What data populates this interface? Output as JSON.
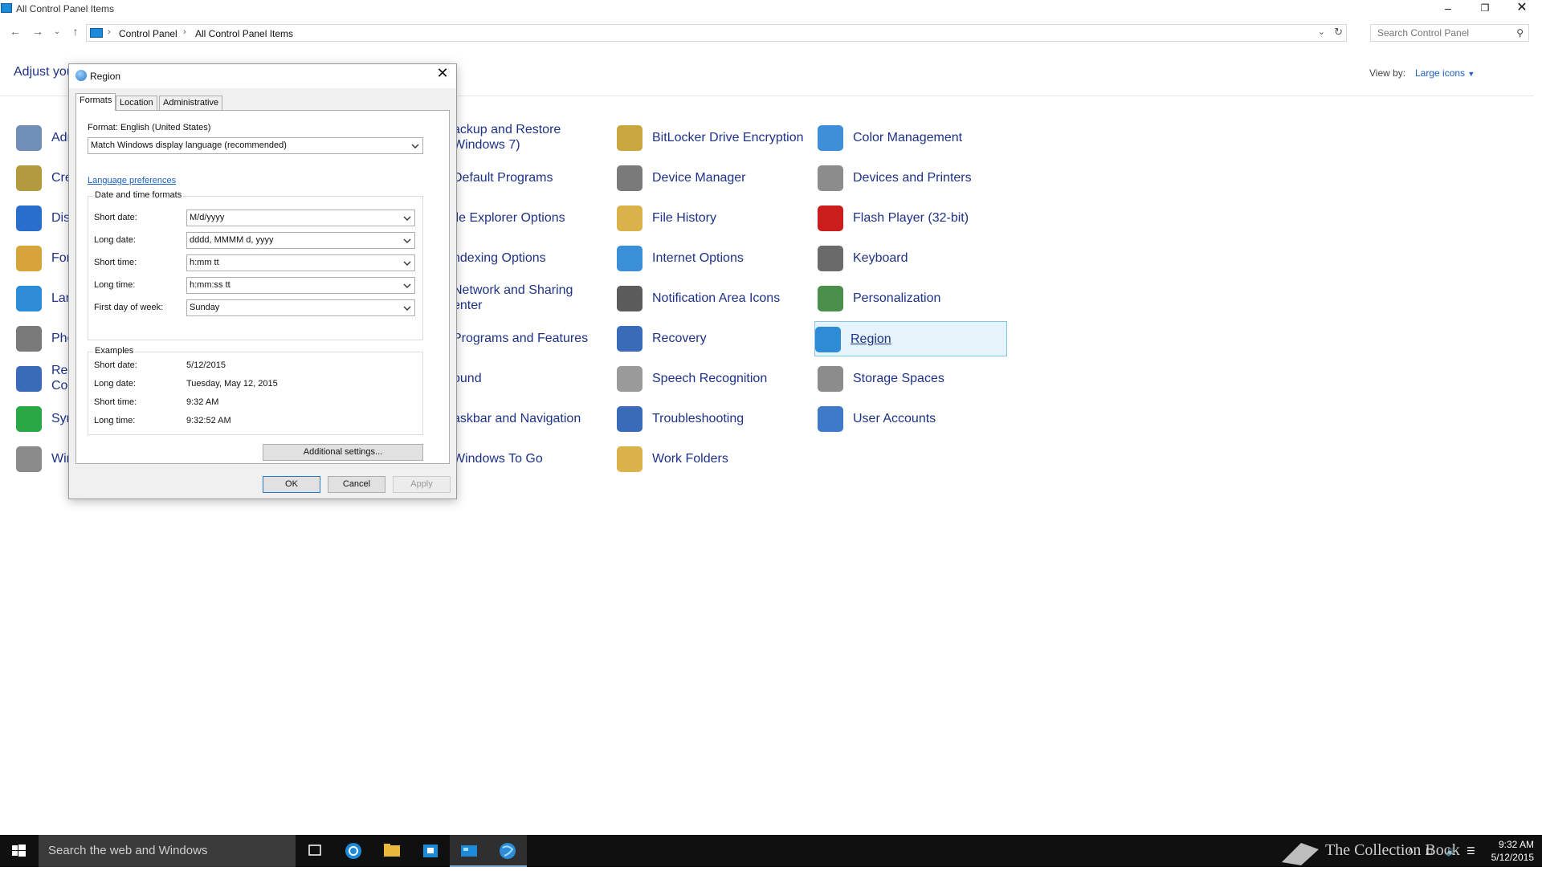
{
  "window": {
    "title": "All Control Panel Items"
  },
  "address": {
    "crumbs": [
      "Control Panel",
      "All Control Panel Items"
    ],
    "search_placeholder": "Search Control Panel"
  },
  "header": {
    "title": "Adjust you",
    "view_by_label": "View by:",
    "view_by_value": "Large icons"
  },
  "items": [
    {
      "label": "Adr",
      "color": "#6f8fb7"
    },
    {
      "label": "Cre",
      "color": "#b39a3f"
    },
    {
      "label": "Dis",
      "color": "#2a6ecc"
    },
    {
      "label": "For",
      "color": "#d6a43a"
    },
    {
      "label": "Lan",
      "color": "#2e8bd6"
    },
    {
      "label": "Pho",
      "color": "#7a7a7a"
    },
    {
      "label": "Rer",
      "label2": "Cor",
      "color": "#3a6bb8"
    },
    {
      "label": "Syr",
      "color": "#2aa846"
    },
    {
      "label": "Wir",
      "color": "#8a8a8a"
    },
    {
      "label": "ackup and Restore",
      "label2": "Windows 7)",
      "color": "#4a9b4a"
    },
    {
      "label": "Default Programs",
      "color": "#3f8fd8"
    },
    {
      "label": "ile Explorer Options",
      "color": "#d9b24a"
    },
    {
      "label": "ndexing Options",
      "color": "#8c8c8c"
    },
    {
      "label": "Network and Sharing",
      "label2": "enter",
      "color": "#3a78c6"
    },
    {
      "label": "Programs and Features",
      "color": "#7a7a7a"
    },
    {
      "label": "ound",
      "color": "#9a9a9a"
    },
    {
      "label": "askbar and Navigation",
      "color": "#6a6a6a"
    },
    {
      "label": "Windows To Go",
      "color": "#3f8fd8"
    },
    {
      "label": "BitLocker Drive Encryption",
      "color": "#c9a640"
    },
    {
      "label": "Device Manager",
      "color": "#7a7a7a"
    },
    {
      "label": "File History",
      "color": "#d9b24a"
    },
    {
      "label": "Internet Options",
      "color": "#3a8fd6"
    },
    {
      "label": "Notification Area Icons",
      "color": "#5b5b5b"
    },
    {
      "label": "Recovery",
      "color": "#3a6bb8"
    },
    {
      "label": "Speech Recognition",
      "color": "#9a9a9a"
    },
    {
      "label": "Troubleshooting",
      "color": "#3a6bb8"
    },
    {
      "label": "Work Folders",
      "color": "#d9b24a"
    },
    {
      "label": "Color Management",
      "color": "#3f8fd8"
    },
    {
      "label": "Devices and Printers",
      "color": "#8c8c8c"
    },
    {
      "label": "Flash Player (32-bit)",
      "color": "#cc1d1d"
    },
    {
      "label": "Keyboard",
      "color": "#6a6a6a"
    },
    {
      "label": "Personalization",
      "color": "#4a8f4a"
    },
    {
      "label": "Region",
      "color": "#2e8bd6"
    },
    {
      "label": "Storage Spaces",
      "color": "#8c8c8c"
    },
    {
      "label": "User Accounts",
      "color": "#3f7ac9"
    }
  ],
  "dialog": {
    "title": "Region",
    "tabs": [
      "Formats",
      "Location",
      "Administrative"
    ],
    "format_label": "Format: English (United States)",
    "format_value": "Match Windows display language (recommended)",
    "language_link": "Language preferences",
    "dt_group_title": "Date and time formats",
    "fields": [
      {
        "label": "Short date:",
        "value": "M/d/yyyy"
      },
      {
        "label": "Long date:",
        "value": "dddd, MMMM d, yyyy"
      },
      {
        "label": "Short time:",
        "value": "h:mm tt"
      },
      {
        "label": "Long time:",
        "value": "h:mm:ss tt"
      },
      {
        "label": "First day of week:",
        "value": "Sunday"
      }
    ],
    "examples_title": "Examples",
    "examples": [
      {
        "label": "Short date:",
        "value": "5/12/2015"
      },
      {
        "label": "Long date:",
        "value": "Tuesday, May 12, 2015"
      },
      {
        "label": "Short time:",
        "value": "9:32 AM"
      },
      {
        "label": "Long time:",
        "value": "9:32:52 AM"
      }
    ],
    "additional_settings": "Additional settings...",
    "ok": "OK",
    "cancel": "Cancel",
    "apply": "Apply"
  },
  "taskbar": {
    "search_text": "Search the web and Windows",
    "time": "9:32 AM",
    "date": "5/12/2015",
    "watermark": "The Collection Book"
  }
}
